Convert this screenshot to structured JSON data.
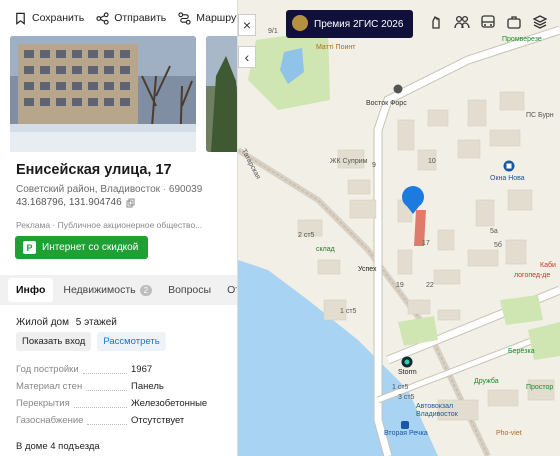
{
  "actions": {
    "save": "Сохранить",
    "send": "Отправить",
    "route": "Маршрут"
  },
  "place": {
    "title": "Енисейская улица, 17",
    "address": "Советский район, Владивосток",
    "postcode": "690039",
    "coordinates": "43.168796, 131.904746"
  },
  "ad": {
    "label": "Реклама · Публичное акционерное общество...",
    "button": "Интернет со скидкой"
  },
  "tabs": [
    {
      "label": "Инфо"
    },
    {
      "label": "Недвижимость",
      "badge": "2"
    },
    {
      "label": "Вопросы"
    },
    {
      "label": "Отз"
    }
  ],
  "house": {
    "type": "Жилой дом",
    "floors": "5 этажей",
    "show_entrance": "Показать вход",
    "review": "Рассмотреть",
    "props": [
      {
        "key": "Год постройки",
        "value": "1967"
      },
      {
        "key": "Материал стен",
        "value": "Панель"
      },
      {
        "key": "Перекрытия",
        "value": "Железобетонные"
      },
      {
        "key": "Газоснабжение",
        "value": "Отсутствует"
      }
    ],
    "porches": "В доме 4 подъезда"
  },
  "map": {
    "promo": "Премия 2ГИС 2026",
    "close": "×",
    "collapse": "‹",
    "labels": {
      "matti": "Матті Поинт",
      "vostok": "Восток Форс",
      "promverezhe": "Промверезе",
      "pcbur": "ПС Бурн",
      "tatarskaya": "Татарская",
      "suprim": "ЖК Суприм",
      "oknanova": "Окна Нова",
      "sklad": "склад",
      "uspekh": "Успех",
      "kabi": "Каби",
      "logoped": "логопед-де",
      "bereza": "Берёзка",
      "storm": "Storm",
      "druzhba": "Дружба",
      "prostor": "Простор",
      "avtovokzal": "Автовокзал",
      "vladivostok": "Владивосток",
      "vtoraya": "Вторая Речка",
      "phoviet": "Pho-viet",
      "n17": "17",
      "n19": "19",
      "n22": "22",
      "n9": "9",
      "n10": "10",
      "n2c": "2 ст5",
      "n1c": "1 ст5",
      "n5a": "5а",
      "n5b": "5б",
      "n1c2": "1 ст5",
      "n3c": "3 ст5",
      "n9_1": "9/1"
    }
  },
  "colors": {
    "accent": "#1fa033",
    "pin": "#1d7be0",
    "promo_bg": "#10103a"
  }
}
